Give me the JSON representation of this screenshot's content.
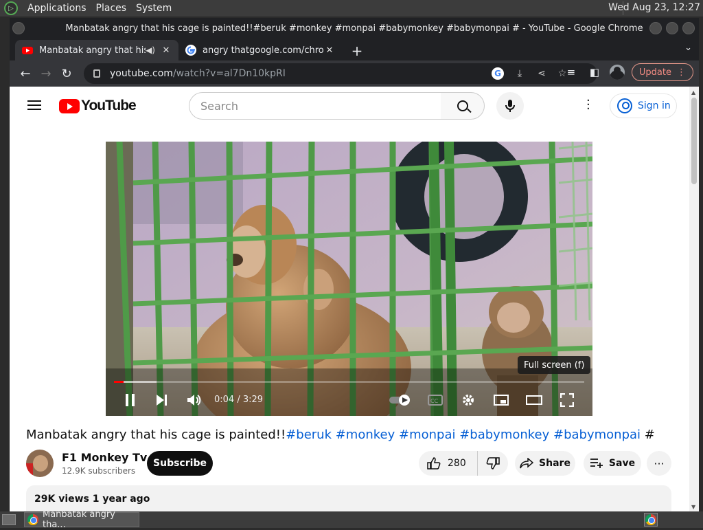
{
  "os_panel": {
    "menus": [
      "Applications",
      "Places",
      "System"
    ],
    "clock": "Wed Aug 23, 12:27"
  },
  "window": {
    "title": "Manbatak angry that his cage is painted!!#beruk #monkey #monpai #babymonkey #babymonpai # - YouTube - Google Chrome"
  },
  "tabs": [
    {
      "title": "Manbatak angry that his c",
      "favicon": "youtube-icon",
      "audio": true,
      "active": true
    },
    {
      "title": "angry thatgoogle.com/chrome",
      "favicon": "google-icon",
      "audio": false,
      "active": false
    }
  ],
  "toolbar": {
    "url_host": "youtube.com",
    "url_path": "/watch?v=al7Dn10kpRI",
    "update_label": "Update"
  },
  "youtube": {
    "logo_text": "YouTube",
    "search_placeholder": "Search",
    "signin_label": "Sign in",
    "player": {
      "time": "0:04 / 3:29",
      "progress_played": 0.02,
      "progress_buffered": 0.09,
      "tooltip": "Full screen (f)"
    },
    "video_title_plain": "Manbatak angry that his cage is painted!!",
    "video_title_tags": "#beruk #monkey #monpai #babymonkey #babymonpai",
    "video_title_tail": " #",
    "channel_name": "F1 Monkey Tv",
    "channel_subs": "12.9K subscribers",
    "subscribe_label": "Subscribe",
    "likes": "280",
    "share_label": "Share",
    "save_label": "Save",
    "description_meta": "29K views  1 year ago"
  },
  "taskbar": {
    "item_label": "Manbatak angry tha..."
  },
  "colors": {
    "youtube_red": "#ff0000",
    "link_blue": "#065fd4",
    "chrome_dark": "#202124",
    "chrome_toolbar": "#35363a"
  }
}
